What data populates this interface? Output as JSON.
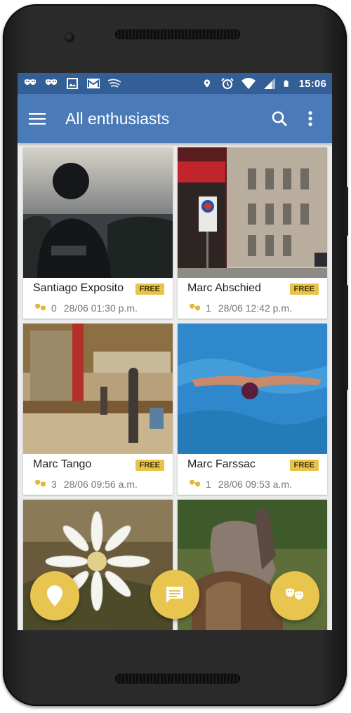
{
  "status_bar": {
    "time": "15:06",
    "left_icons": [
      "masks-icon",
      "masks-icon",
      "image-icon",
      "gmail-icon",
      "cast-icon"
    ],
    "right_icons": [
      "location-icon",
      "alarm-icon",
      "wifi-icon",
      "signal-icon",
      "battery-icon"
    ]
  },
  "app_bar": {
    "title": "All enthusiasts",
    "menu_icon": "hamburger-menu-icon",
    "actions": [
      "search-icon",
      "more-vert-icon"
    ]
  },
  "cards": [
    {
      "name": "Santiago Exposito",
      "badge": "FREE",
      "count": "0",
      "time": "28/06 01:30 p.m.",
      "photo": "man-silhouette-sea"
    },
    {
      "name": "Marc Abschied",
      "badge": "FREE",
      "count": "1",
      "time": "28/06 12:42 p.m.",
      "photo": "street-building"
    },
    {
      "name": "Marc Tango",
      "badge": "FREE",
      "count": "3",
      "time": "28/06 09:56 a.m.",
      "photo": "painted-cafe-interior"
    },
    {
      "name": "Marc Farssac",
      "badge": "FREE",
      "count": "1",
      "time": "28/06 09:53 a.m.",
      "photo": "swimmer-butterfly"
    },
    {
      "photo": "edelweiss-flower"
    },
    {
      "photo": "horses"
    }
  ],
  "fabs": [
    "location-pin-icon",
    "chat-icon",
    "masks-icon"
  ],
  "colors": {
    "status_bar": "#345f96",
    "app_bar": "#4a7ab8",
    "accent": "#e8c54f",
    "badge": "#e8c34a"
  }
}
